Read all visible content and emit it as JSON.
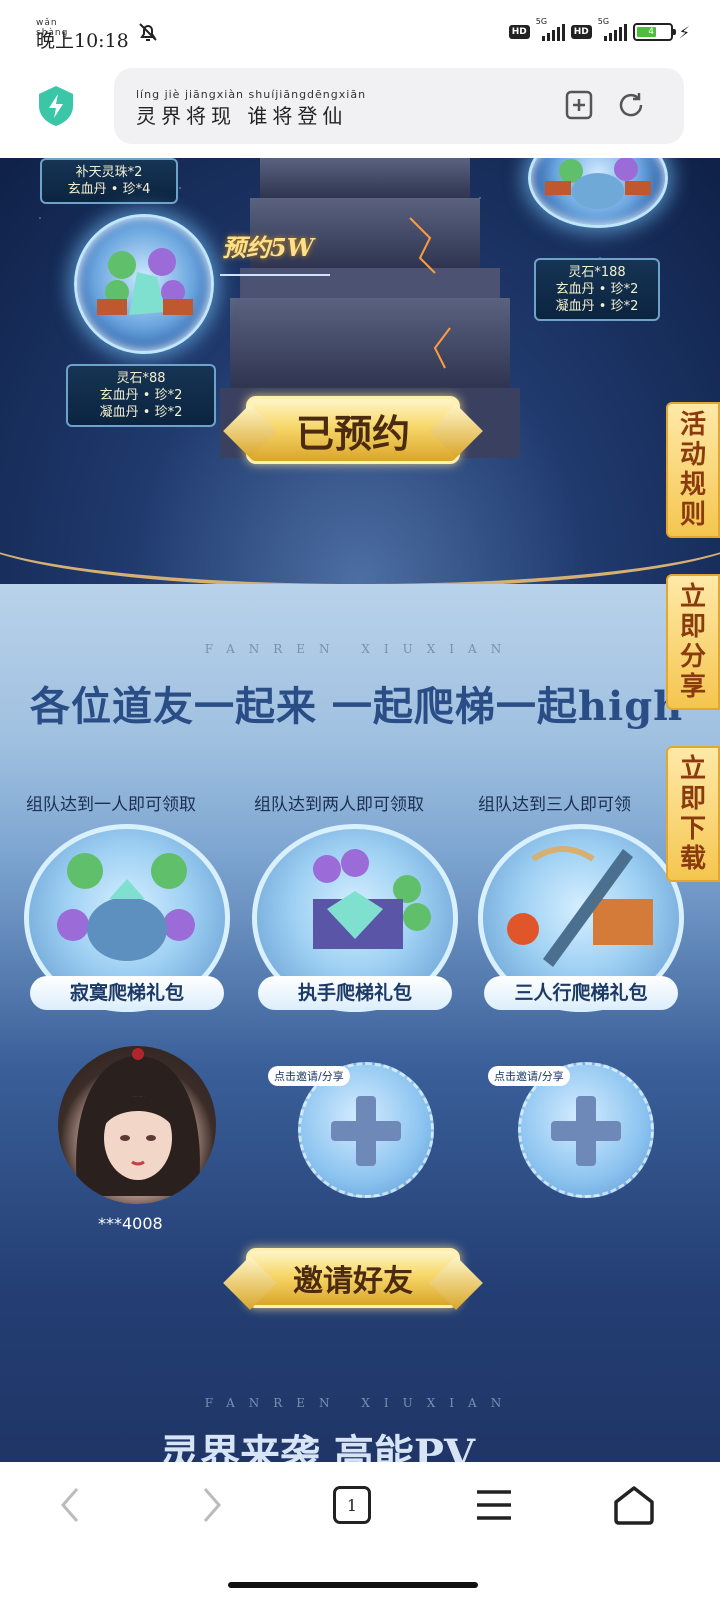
{
  "status_bar": {
    "time_pinyin": "wǎn shàng",
    "time": "晚上10:18",
    "network_1": "HD",
    "network_1_gen": "5G",
    "network_2": "HD",
    "network_2_gen": "5G",
    "battery": "4"
  },
  "address_bar": {
    "title_pinyin": "líng  jiè  jiāngxiàn  shuíjiāngdēngxiān",
    "title": "灵界将现 谁将登仙"
  },
  "top_section": {
    "reward_left_top": [
      "补天灵珠*2",
      "玄血丹 • 珍*4"
    ],
    "milestone_label": "预约5W",
    "reward_left": [
      "灵石*88",
      "玄血丹 • 珍*2",
      "凝血丹 • 珍*2"
    ],
    "reward_right": [
      "灵石*188",
      "玄血丹 • 珍*2",
      "凝血丹 • 珍*2"
    ],
    "reserved_button": "已预约"
  },
  "side_tabs": {
    "rules": "活动规则",
    "share": "立即分享",
    "download": "立即下载"
  },
  "team_section": {
    "watermark": "FANREN XIUXIAN",
    "headline": "各位道友一起来 一起爬梯一起high",
    "tiers": [
      {
        "requirement": "组队达到一人即可领取",
        "pack_name": "寂寞爬梯礼包"
      },
      {
        "requirement": "组队达到两人即可领取",
        "pack_name": "执手爬梯礼包"
      },
      {
        "requirement": "组队达到三人即可领",
        "pack_name": "三人行爬梯礼包"
      }
    ],
    "member_id": "***4008",
    "invite_tag": "点击邀请/分享",
    "invite_button": "邀请好友"
  },
  "pv_section": {
    "watermark": "FANREN XIUXIAN",
    "title": "灵界来袭 高能PV"
  },
  "bottom_nav": {
    "tab_count": "1"
  }
}
